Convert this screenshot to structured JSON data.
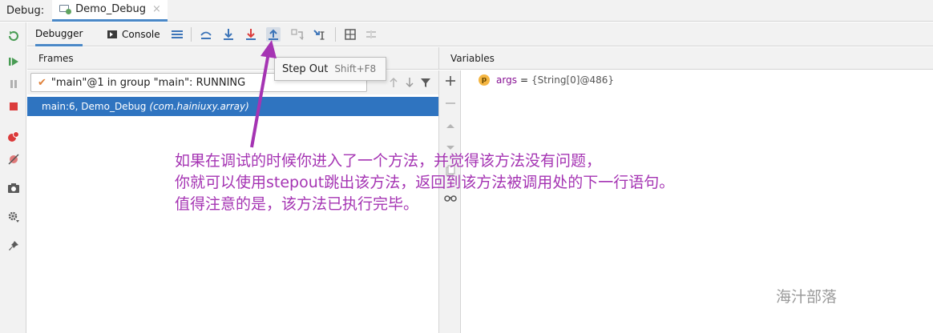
{
  "titlebar": {
    "label": "Debug:",
    "tab_name": "Demo_Debug",
    "tab_close": "×"
  },
  "toolbar": {
    "debugger_label": "Debugger",
    "console_label": "Console"
  },
  "frames": {
    "header": "Frames",
    "thread_select": "\"main\"@1 in group \"main\": RUNNING",
    "selected_frame": "main:6, Demo_Debug",
    "selected_frame_pkg": "(com.hainiuxy.array)"
  },
  "variables": {
    "header": "Variables",
    "items": [
      {
        "badge": "p",
        "name": "args",
        "eq": "=",
        "value": "{String[0]@486}"
      }
    ]
  },
  "tooltip": {
    "title": "Step Out",
    "shortcut": "Shift+F8"
  },
  "annotation": {
    "line1": "如果在调试的时候你进入了一个方法，并觉得该方法没有问题，",
    "line2": "你就可以使用stepout跳出该方法，返回到该方法被调用处的下一行语句。",
    "line3": "值得注意的是，该方法已执行完毕。"
  },
  "watermark": "海汁部落",
  "colors": {
    "selection": "#2f74c0",
    "annotation": "#a534b3",
    "accent": "#4a88c7"
  },
  "icons": {
    "left_toolbar": [
      "rerun-icon",
      "resume-icon",
      "pause-icon",
      "stop-icon",
      "view-breakpoints-icon",
      "mute-breakpoints-icon",
      "camera-icon",
      "settings-icon",
      "pin-icon"
    ],
    "toolbar": [
      "menu-icon",
      "show-execution-point-icon",
      "step-over-icon",
      "step-into-icon",
      "force-step-into-icon",
      "step-out-icon",
      "drop-frame-icon",
      "run-to-cursor-icon",
      "evaluate-expression-icon",
      "trace-icon"
    ]
  }
}
